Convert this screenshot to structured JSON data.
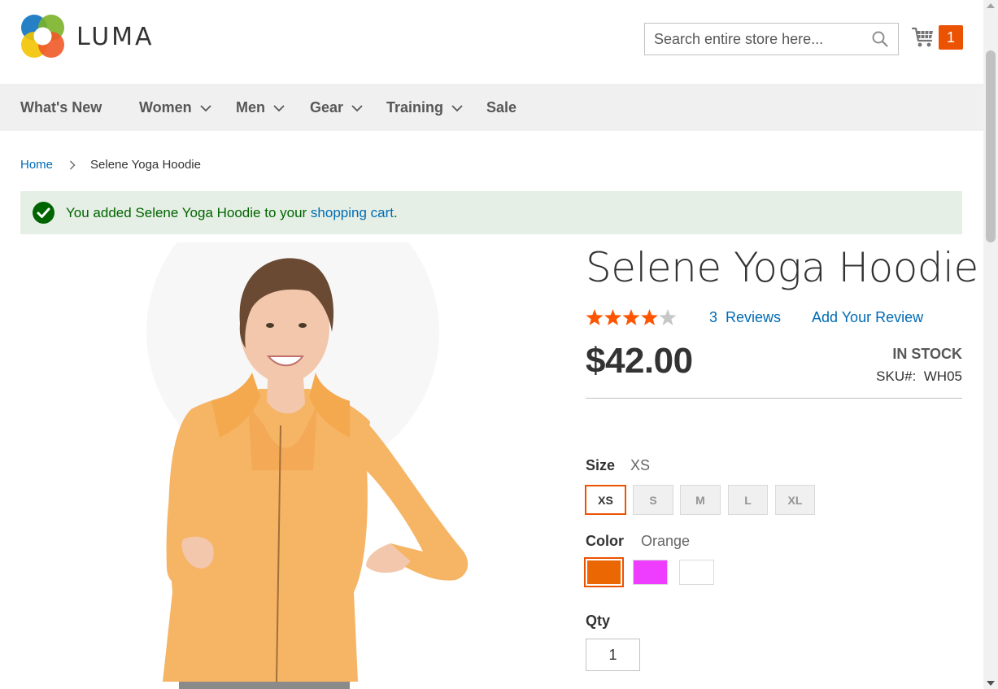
{
  "header": {
    "logo_text": "LUMA",
    "search_placeholder": "Search entire store here...",
    "cart_count": "1"
  },
  "nav": {
    "items": [
      {
        "label": "What's New",
        "has_dropdown": false
      },
      {
        "label": "Women",
        "has_dropdown": true
      },
      {
        "label": "Men",
        "has_dropdown": true
      },
      {
        "label": "Gear",
        "has_dropdown": true
      },
      {
        "label": "Training",
        "has_dropdown": true
      },
      {
        "label": "Sale",
        "has_dropdown": false
      }
    ]
  },
  "breadcrumb": {
    "home": "Home",
    "current": "Selene Yoga Hoodie"
  },
  "message": {
    "text_before": "You added Selene Yoga Hoodie to your ",
    "link": "shopping cart",
    "text_after": "."
  },
  "product": {
    "title": "Selene Yoga Hoodie",
    "rating_out_of_5": 4,
    "reviews_count": "3",
    "reviews_label": "Reviews",
    "add_review": "Add Your Review",
    "price": "$42.00",
    "stock": "IN STOCK",
    "sku_label": "SKU#:",
    "sku": "WH05"
  },
  "options": {
    "size_label": "Size",
    "size_selected": "XS",
    "sizes": [
      "XS",
      "S",
      "M",
      "L",
      "XL"
    ],
    "color_label": "Color",
    "color_selected": "Orange",
    "colors": [
      "#eb6703",
      "#ef3dff",
      "#ffffff"
    ],
    "qty_label": "Qty",
    "qty_value": "1"
  },
  "colors": {
    "accent": "#eb5202",
    "link": "#006bb4",
    "success_bg": "#e5efe5",
    "success_text": "#006400"
  }
}
